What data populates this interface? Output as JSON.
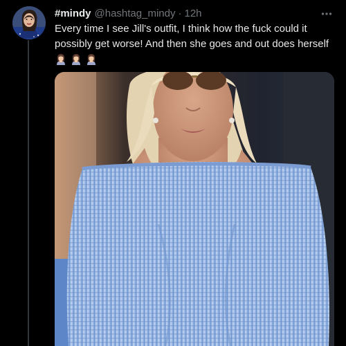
{
  "tweet": {
    "display_name": "#mindy",
    "handle": "@hashtag_mindy",
    "separator": "·",
    "time": "12h",
    "text": "Every time I see Jill's outfit, I think how the fuck could it\npossibly get worse! And then she goes and out does herself",
    "emoji_icons": [
      "woman-facepalming-icon",
      "woman-facepalming-icon",
      "woman-facepalming-icon"
    ],
    "more_icon": "more-horizontal-icon"
  },
  "colors": {
    "background": "#000000",
    "text_primary": "#e7e9ea",
    "text_secondary": "#71767b",
    "thread_line": "#333639",
    "dress_blue": "#8fb0e0"
  }
}
